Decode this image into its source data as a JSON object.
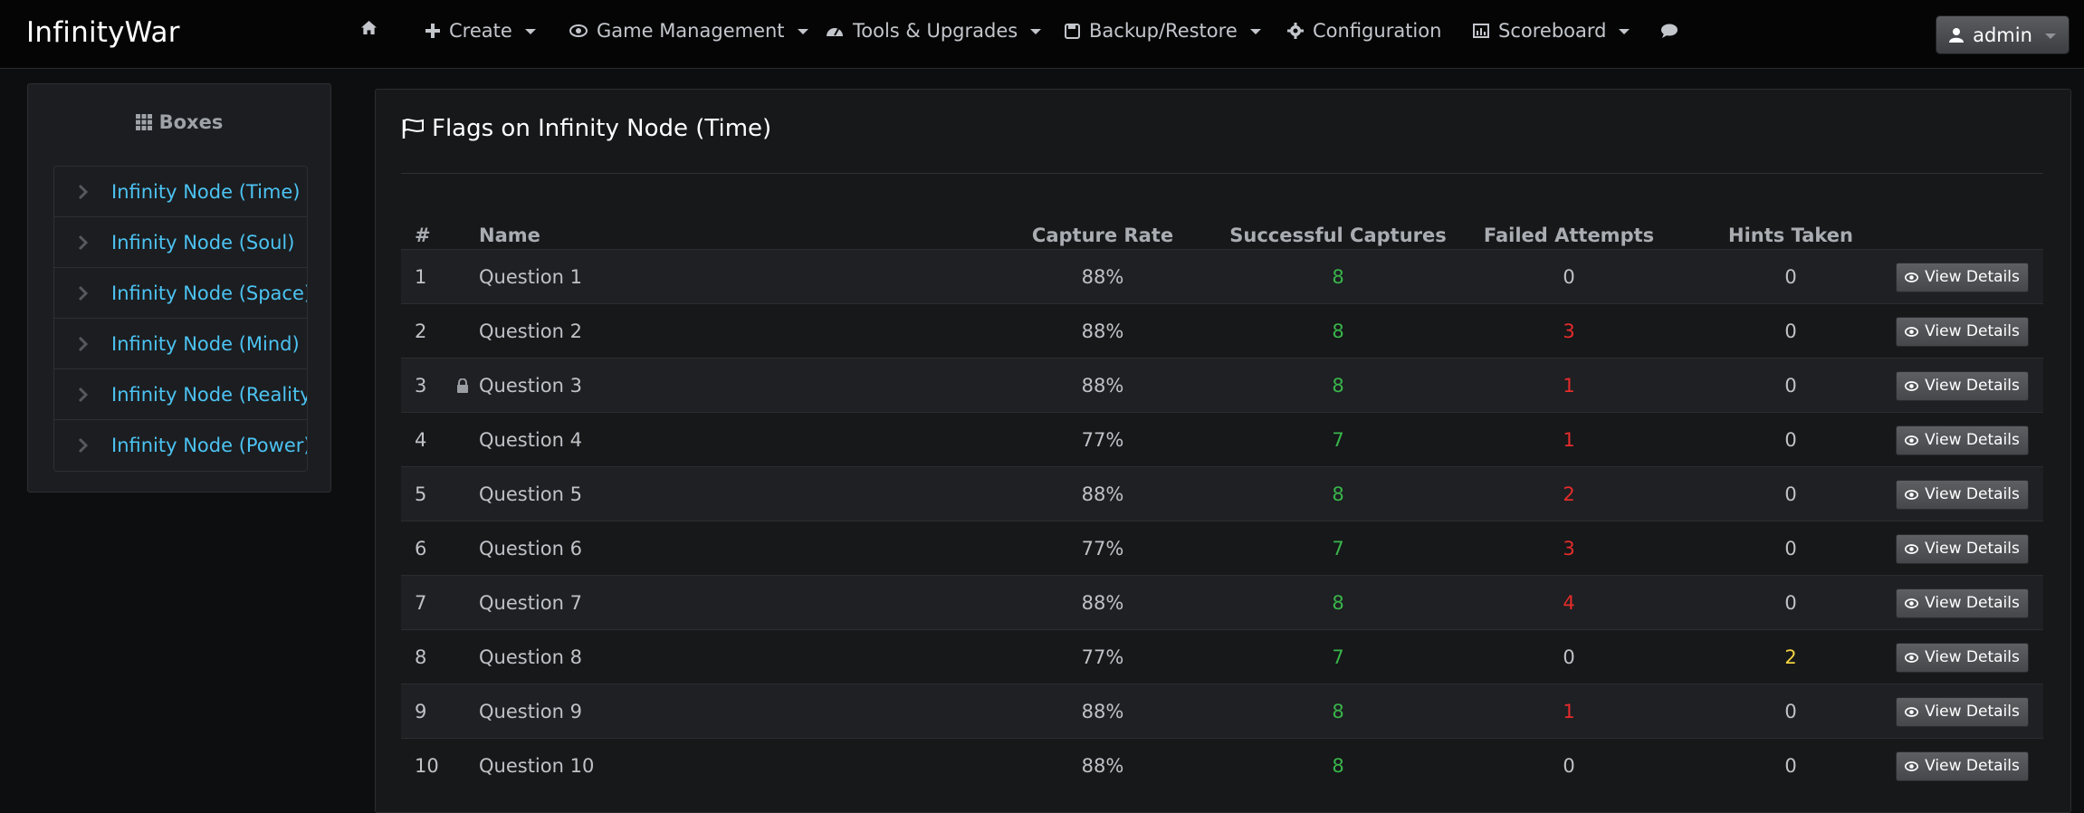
{
  "app": {
    "brand": "InfinityWar"
  },
  "nav": {
    "home_icon": "home-icon",
    "items": [
      {
        "label": "Create",
        "icon": "plus-icon",
        "dropdown": true
      },
      {
        "label": "Game Management",
        "icon": "eye-icon",
        "dropdown": true
      },
      {
        "label": "Tools & Upgrades",
        "icon": "dashboard-icon",
        "dropdown": true
      },
      {
        "label": "Backup/Restore",
        "icon": "floppy-icon",
        "dropdown": true
      },
      {
        "label": "Configuration",
        "icon": "gear-icon",
        "dropdown": false
      },
      {
        "label": "Scoreboard",
        "icon": "bar-chart-icon",
        "dropdown": true
      }
    ],
    "chat_icon": "chat-icon",
    "user": {
      "label": "admin",
      "icon": "user-icon"
    }
  },
  "sidebar": {
    "title": "Boxes",
    "title_icon": "grid-icon",
    "items": [
      {
        "label": "Infinity Node (Time)"
      },
      {
        "label": "Infinity Node (Soul)"
      },
      {
        "label": "Infinity Node (Space)"
      },
      {
        "label": "Infinity Node (Mind)"
      },
      {
        "label": "Infinity Node (Reality)"
      },
      {
        "label": "Infinity Node (Power)"
      }
    ]
  },
  "main": {
    "title": "Flags on Infinity Node (Time)",
    "title_icon": "flag-icon",
    "columns": {
      "num": "#",
      "name": "Name",
      "rate": "Capture Rate",
      "success": "Successful Captures",
      "failed": "Failed Attempts",
      "hints": "Hints Taken"
    },
    "button_label": "View Details",
    "rows": [
      {
        "num": "1",
        "name": "Question 1",
        "locked": false,
        "rate": "88%",
        "success": "8",
        "failed": "0",
        "hints": "0"
      },
      {
        "num": "2",
        "name": "Question 2",
        "locked": false,
        "rate": "88%",
        "success": "8",
        "failed": "3",
        "hints": "0"
      },
      {
        "num": "3",
        "name": "Question 3",
        "locked": true,
        "rate": "88%",
        "success": "8",
        "failed": "1",
        "hints": "0"
      },
      {
        "num": "4",
        "name": "Question 4",
        "locked": false,
        "rate": "77%",
        "success": "7",
        "failed": "1",
        "hints": "0"
      },
      {
        "num": "5",
        "name": "Question 5",
        "locked": false,
        "rate": "88%",
        "success": "8",
        "failed": "2",
        "hints": "0"
      },
      {
        "num": "6",
        "name": "Question 6",
        "locked": false,
        "rate": "77%",
        "success": "7",
        "failed": "3",
        "hints": "0"
      },
      {
        "num": "7",
        "name": "Question 7",
        "locked": false,
        "rate": "88%",
        "success": "8",
        "failed": "4",
        "hints": "0"
      },
      {
        "num": "8",
        "name": "Question 8",
        "locked": false,
        "rate": "77%",
        "success": "7",
        "failed": "0",
        "hints": "2"
      },
      {
        "num": "9",
        "name": "Question 9",
        "locked": false,
        "rate": "88%",
        "success": "8",
        "failed": "1",
        "hints": "0"
      },
      {
        "num": "10",
        "name": "Question 10",
        "locked": false,
        "rate": "88%",
        "success": "8",
        "failed": "0",
        "hints": "0"
      }
    ]
  },
  "colors": {
    "success": "#39b54a",
    "failed": "#e52b2b",
    "hints": "#f3d23f",
    "link": "#4cc3f2"
  }
}
